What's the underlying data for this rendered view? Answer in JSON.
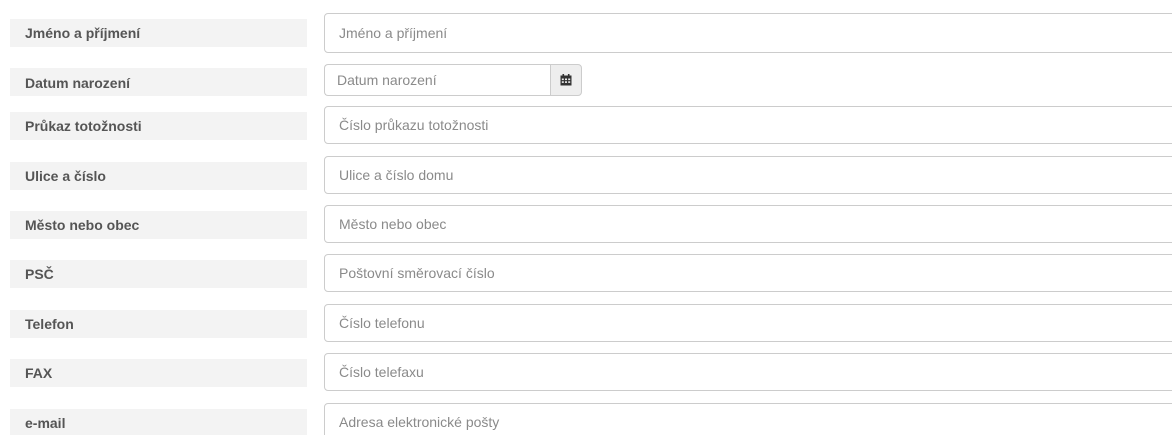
{
  "form": {
    "fields": [
      {
        "label": "Jméno a příjmení",
        "placeholder": "Jméno a příjmení"
      },
      {
        "label": "Datum narození",
        "placeholder": "Datum narození",
        "icon": "calendar-icon"
      },
      {
        "label": "Průkaz totožnosti",
        "placeholder": "Číslo průkazu totožnosti"
      },
      {
        "label": "Ulice a číslo",
        "placeholder": "Ulice a číslo domu"
      },
      {
        "label": "Město nebo obec",
        "placeholder": "Město nebo obec"
      },
      {
        "label": "PSČ",
        "placeholder": "Poštovní směrovací číslo"
      },
      {
        "label": "Telefon",
        "placeholder": "Číslo telefonu"
      },
      {
        "label": "FAX",
        "placeholder": "Číslo telefaxu"
      },
      {
        "label": "e-mail",
        "placeholder": "Adresa elektronické pošty"
      }
    ]
  }
}
